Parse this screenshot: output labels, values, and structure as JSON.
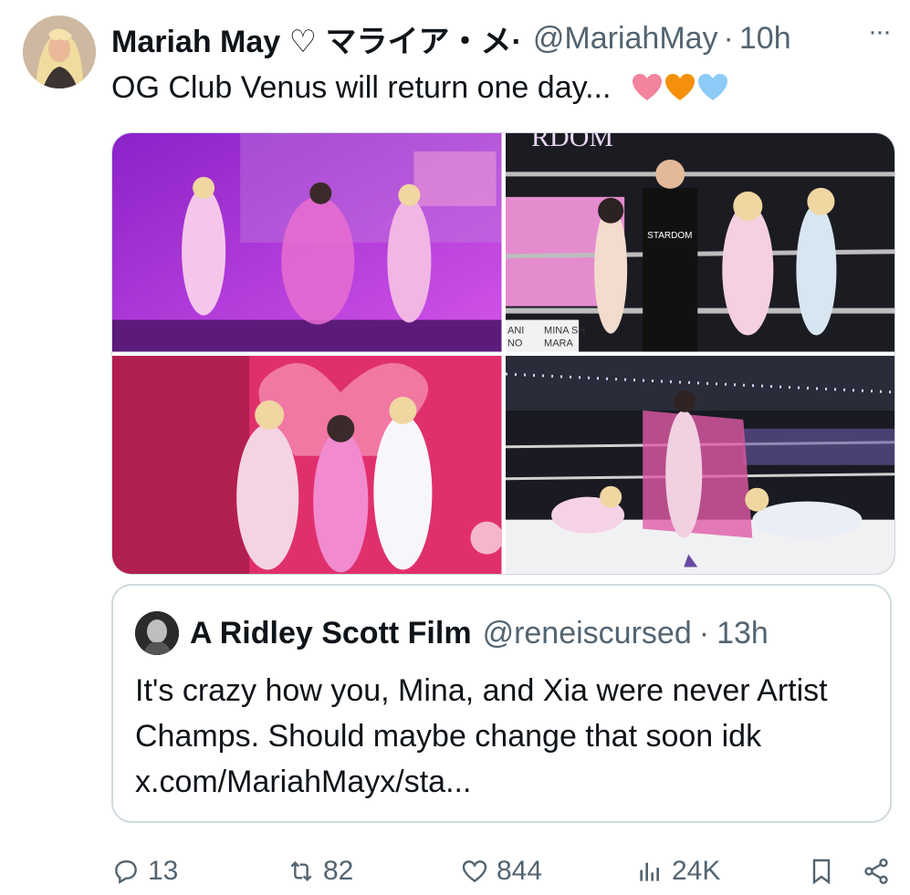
{
  "tweet": {
    "author_name": "Mariah May ♡ マライア・メ·",
    "handle": "@MariahMay",
    "separator": "·",
    "time": "10h",
    "more": "···",
    "text": "OG Club Venus will return one day...",
    "emojis": [
      "pink-heart-icon",
      "orange-heart-icon",
      "light-blue-heart-icon"
    ]
  },
  "media": {
    "images": [
      {
        "name": "stage-entrance-photo",
        "accent": "#b63de0"
      },
      {
        "name": "ring-referee-photo",
        "accent": "#1b1b1f"
      },
      {
        "name": "heart-stage-photo",
        "accent": "#f0508c"
      },
      {
        "name": "arena-ring-pose-photo",
        "accent": "#222431"
      }
    ],
    "overlay_text": {
      "stardom_top": "RDOM",
      "stardom_vest": "STARDOM",
      "poster_left": "ANI",
      "poster_left2": "NO",
      "poster_right": "MINA SH",
      "poster_right2": "MARA"
    }
  },
  "quote": {
    "author_name": "A Ridley Scott Film",
    "handle": "@reneiscursed",
    "separator": "·",
    "time": "13h",
    "text": "It's crazy how you, Mina, and Xia were never Artist Champs. Should maybe change that soon idk x.com/MariahMayx/sta..."
  },
  "actions": {
    "replies": "13",
    "retweets": "82",
    "likes": "844",
    "views": "24K"
  },
  "colors": {
    "text": "#0f1419",
    "secondary": "#536471",
    "border": "#cfd9de",
    "pink_heart": "#f2849e",
    "orange_heart": "#f4900c",
    "blue_heart": "#8ccaf7"
  }
}
